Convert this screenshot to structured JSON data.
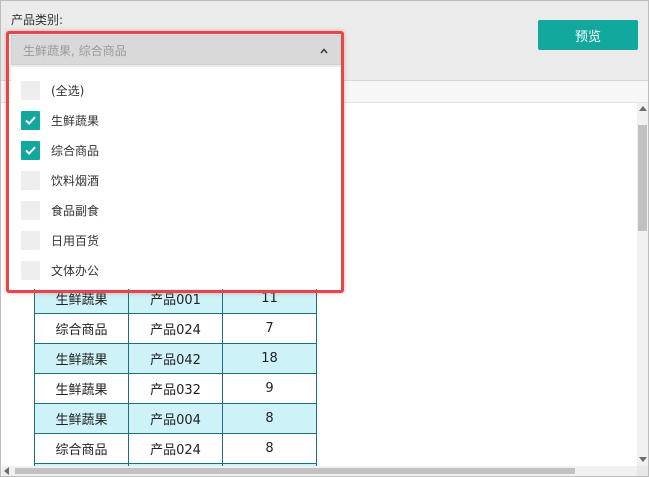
{
  "filter": {
    "label": "产品类别:",
    "selected_display": "生鲜蔬果, 综合商品",
    "options": [
      {
        "label": "(全选)",
        "checked": false
      },
      {
        "label": "生鲜蔬果",
        "checked": true
      },
      {
        "label": "综合商品",
        "checked": true
      },
      {
        "label": "饮料烟酒",
        "checked": false
      },
      {
        "label": "食品副食",
        "checked": false
      },
      {
        "label": "日用百货",
        "checked": false
      },
      {
        "label": "文体办公",
        "checked": false
      }
    ]
  },
  "toolbar": {
    "preview_label": "预览"
  },
  "table": {
    "rows": [
      {
        "category": "",
        "product": "",
        "qty": ""
      },
      {
        "category": "",
        "product": "",
        "qty": ""
      },
      {
        "category": "",
        "product": "",
        "qty": ""
      },
      {
        "category": "",
        "product": "",
        "qty": ""
      },
      {
        "category": "",
        "product": "",
        "qty": ""
      },
      {
        "category": "",
        "product": "",
        "qty": ""
      },
      {
        "category": "生鲜蔬果",
        "product": "产品001",
        "qty": "11"
      },
      {
        "category": "综合商品",
        "product": "产品024",
        "qty": "7"
      },
      {
        "category": "生鲜蔬果",
        "product": "产品042",
        "qty": "18"
      },
      {
        "category": "生鲜蔬果",
        "product": "产品032",
        "qty": "9"
      },
      {
        "category": "生鲜蔬果",
        "product": "产品004",
        "qty": "8"
      },
      {
        "category": "综合商品",
        "product": "产品024",
        "qty": "8"
      },
      {
        "category": "",
        "product": "",
        "qty": ""
      }
    ]
  },
  "colors": {
    "accent": "#13a89e",
    "highlight_border": "#e2474b",
    "row_alt": "#cdf3f8",
    "table_border": "#1f6f78"
  }
}
